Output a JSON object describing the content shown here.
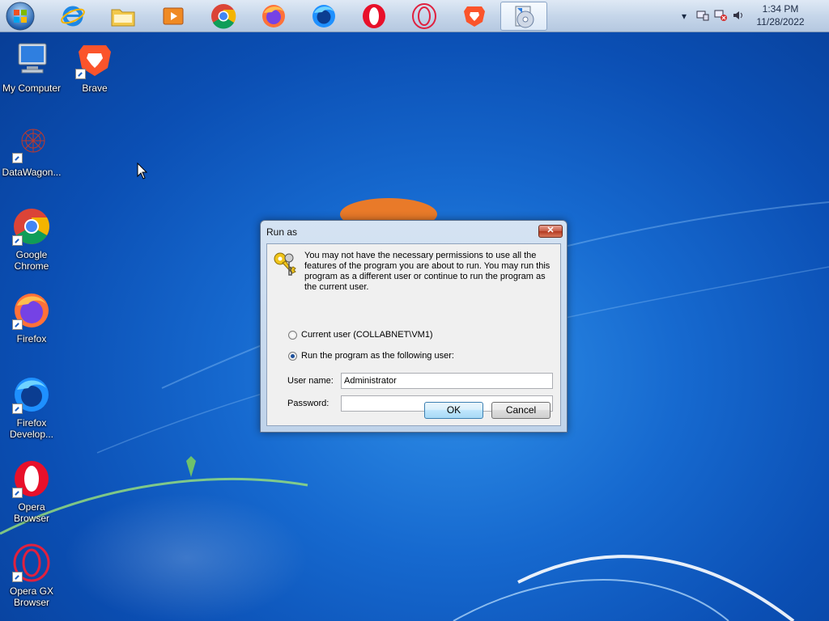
{
  "taskbar": {
    "start_icon": "windows-start-orb",
    "pinned": [
      {
        "name": "internet-explorer-icon"
      },
      {
        "name": "file-explorer-icon"
      },
      {
        "name": "media-player-icon"
      },
      {
        "name": "chrome-icon"
      },
      {
        "name": "firefox-icon"
      },
      {
        "name": "firefox-developer-icon"
      },
      {
        "name": "opera-icon"
      },
      {
        "name": "opera-gx-icon"
      },
      {
        "name": "brave-icon"
      },
      {
        "name": "run-as-setup-icon",
        "active": true
      }
    ],
    "tray": {
      "time": "1:34 PM",
      "date": "11/28/2022"
    }
  },
  "desktop": {
    "icons": [
      {
        "label": "My Computer",
        "icon": "computer-icon"
      },
      {
        "label": "Brave",
        "icon": "brave-icon"
      },
      {
        "label": "DataWagon...",
        "icon": "datawagon-icon"
      },
      {
        "label": "Google Chrome",
        "icon": "chrome-icon"
      },
      {
        "label": "Firefox",
        "icon": "firefox-icon"
      },
      {
        "label": "Firefox Develop...",
        "icon": "firefox-developer-icon"
      },
      {
        "label": "Opera Browser",
        "icon": "opera-icon"
      },
      {
        "label": "Opera GX Browser",
        "icon": "opera-gx-icon"
      }
    ]
  },
  "dialog": {
    "title": "Run as",
    "close_label": "✕",
    "message": "You may not have the necessary permissions to use all the features of the program you are about to run. You may run this program as a different user or continue to run the program as the current user.",
    "option_current": "Current user (COLLABNET\\VM1)",
    "option_other": "Run the program as the following user:",
    "selected_option": "other",
    "username_label": "User name:",
    "username_value": "Administrator",
    "password_label": "Password:",
    "password_value": "",
    "ok_label": "OK",
    "cancel_label": "Cancel"
  }
}
